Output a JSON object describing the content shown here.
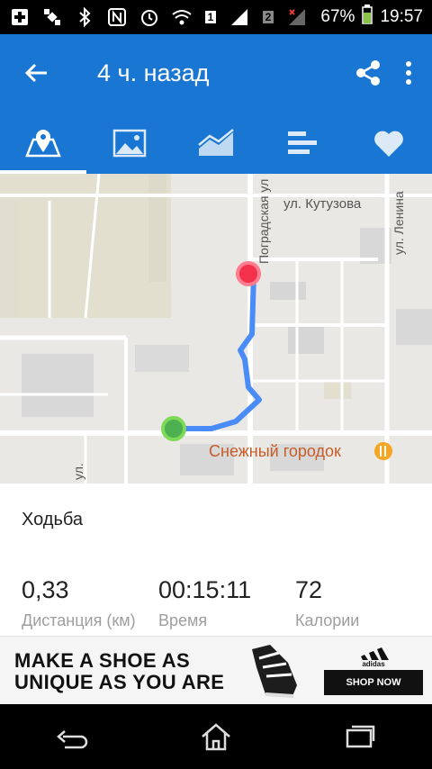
{
  "status_bar": {
    "battery": "67%",
    "time": "19:57",
    "sim1": "1",
    "sim2": "2"
  },
  "app_bar": {
    "title": "4 ч. назад"
  },
  "tabs": [
    {
      "icon": "map-icon",
      "active": true
    },
    {
      "icon": "photo-icon"
    },
    {
      "icon": "chart-icon"
    },
    {
      "icon": "stats-icon"
    },
    {
      "icon": "heart-icon"
    }
  ],
  "map": {
    "streets": [
      "ул. Кутузова",
      "Поградская ул",
      "ул. Ленина",
      "ул."
    ],
    "place_name": "Снежный городок"
  },
  "activity": {
    "type": "Ходьба",
    "stats": [
      {
        "value": "0,33",
        "label": "Дистанция (км)"
      },
      {
        "value": "00:15:11",
        "label": "Время"
      },
      {
        "value": "72",
        "label": "Калории"
      }
    ]
  },
  "ad": {
    "line1": "MAKE A SHOE AS",
    "line2": "UNIQUE AS YOU ARE",
    "brand": "adidas",
    "cta": "SHOP NOW"
  },
  "colors": {
    "primary": "#1976d2",
    "route": "#4a8cf7",
    "start": "#4caf50",
    "end": "#f3314b"
  }
}
